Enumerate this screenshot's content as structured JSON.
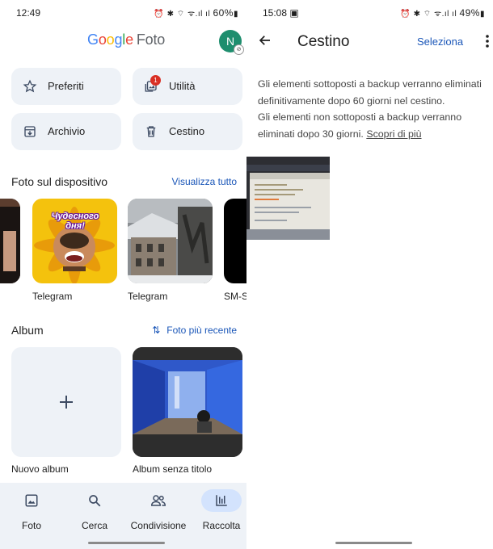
{
  "left": {
    "status": {
      "time": "12:49",
      "battery": "60%"
    },
    "logo": {
      "google": "Google",
      "foto": "Foto"
    },
    "avatar_initial": "N",
    "tiles": [
      {
        "label": "Preferiti",
        "icon": "star-icon"
      },
      {
        "label": "Utilità",
        "icon": "utilities-icon",
        "badge": "1"
      },
      {
        "label": "Archivio",
        "icon": "archive-icon"
      },
      {
        "label": "Cestino",
        "icon": "trash-icon"
      }
    ],
    "device_section": {
      "title": "Foto sul dispositivo",
      "link": "Visualizza tutto"
    },
    "device_folders": [
      {
        "label": "Telegram",
        "thumb_text": "Чудесного дня!"
      },
      {
        "label": "Telegram"
      },
      {
        "label": "SM-S"
      }
    ],
    "album_section": {
      "title": "Album",
      "sort": "Foto più recente"
    },
    "albums": [
      {
        "label": "Nuovo album",
        "icon": "plus-icon"
      },
      {
        "label": "Album senza titolo"
      }
    ],
    "nav": [
      {
        "label": "Foto",
        "icon": "photo-icon"
      },
      {
        "label": "Cerca",
        "icon": "search-icon"
      },
      {
        "label": "Condivisione",
        "icon": "sharing-icon"
      },
      {
        "label": "Raccolta",
        "icon": "library-icon",
        "active": true
      }
    ]
  },
  "right": {
    "status": {
      "time": "15:08",
      "battery": "49%"
    },
    "title": "Cestino",
    "select_label": "Seleziona",
    "info_line1": "Gli elementi sottoposti a backup verranno eliminati definitivamente dopo 60 giorni nel cestino.",
    "info_line2": "Gli elementi non sottoposti a backup verranno eliminati dopo 30 giorni.",
    "info_link": "Scopri di più"
  },
  "colors": {
    "accent": "#1a56b8",
    "tile_bg": "#eef2f7",
    "avatar": "#1e8e6e",
    "badge": "#d93025",
    "nav_active": "#d3e3fd"
  }
}
